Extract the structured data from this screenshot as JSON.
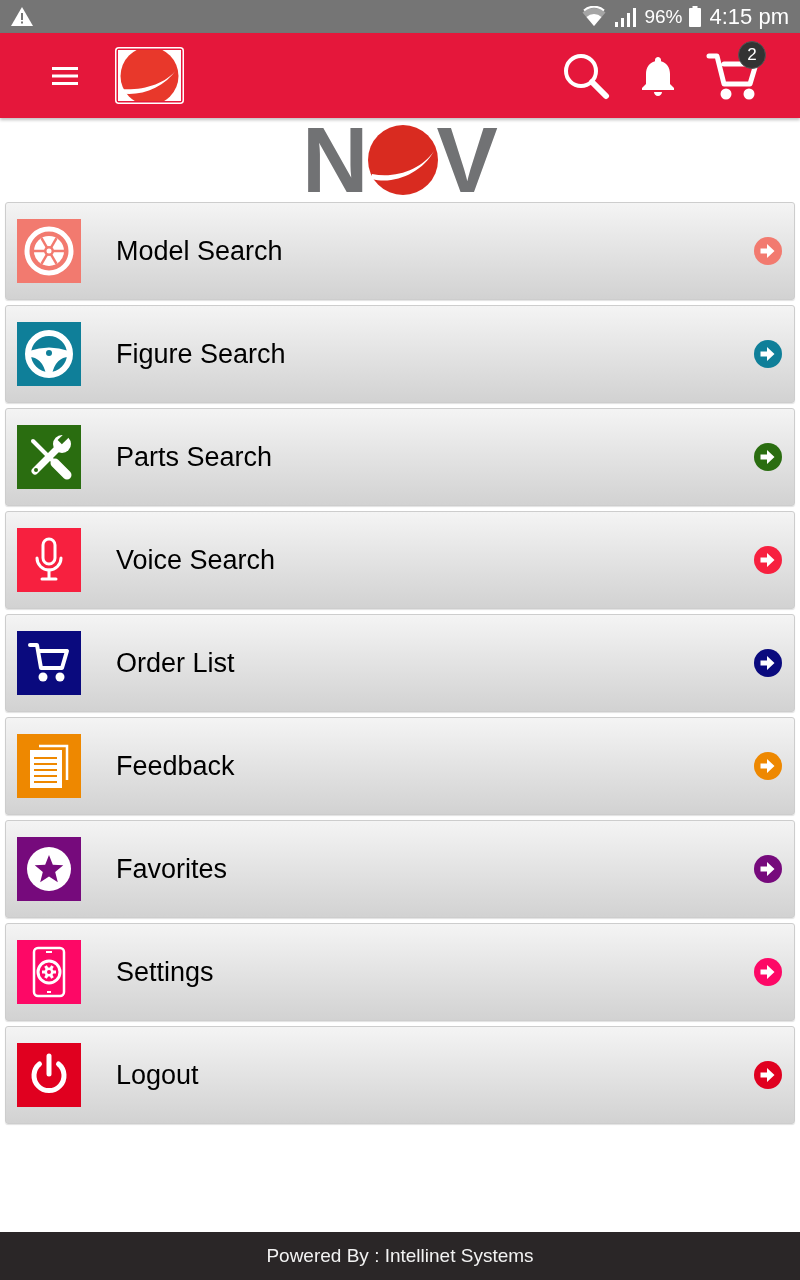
{
  "status_bar": {
    "battery": "96%",
    "time": "4:15 pm"
  },
  "app_bar": {
    "cart_badge": "2"
  },
  "brand_logo": {
    "left_letter": "N",
    "right_letter": "V"
  },
  "menu": {
    "items": [
      {
        "label": "Model Search",
        "color": "#f27a6f"
      },
      {
        "label": "Figure Search",
        "color": "#0f7f99"
      },
      {
        "label": "Parts Search",
        "color": "#2a6d10"
      },
      {
        "label": "Voice Search",
        "color": "#f7203f"
      },
      {
        "label": "Order List",
        "color": "#0a0a7e"
      },
      {
        "label": "Feedback",
        "color": "#ee8800"
      },
      {
        "label": "Favorites",
        "color": "#760a7c"
      },
      {
        "label": "Settings",
        "color": "#fd0866"
      },
      {
        "label": "Logout",
        "color": "#e0001f"
      }
    ]
  },
  "footer": {
    "text": "Powered By : Intellinet Systems"
  }
}
